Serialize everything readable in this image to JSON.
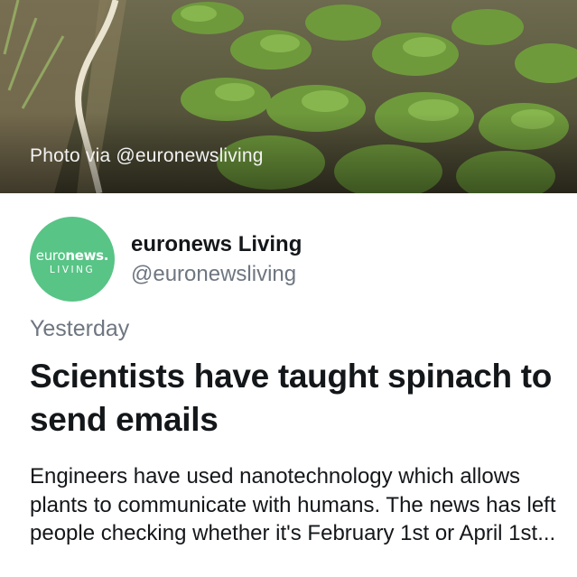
{
  "hero": {
    "photo_credit": "Photo via @euronewsliving"
  },
  "account": {
    "avatar_brand_top_light": "euro",
    "avatar_brand_top_bold": "news.",
    "avatar_brand_sub": "LIVING",
    "name": "euronews Living",
    "handle": "@euronewsliving"
  },
  "post": {
    "timestamp": "Yesterday",
    "headline": "Scientists have taught spinach to send emails",
    "description": "Engineers have used nanotechnology which allows plants to communicate with humans. The news has left people checking whether it's February 1st or April 1st..."
  },
  "colors": {
    "avatar_green": "#58c486",
    "text_primary": "#14171a",
    "text_secondary": "#6e7680"
  }
}
